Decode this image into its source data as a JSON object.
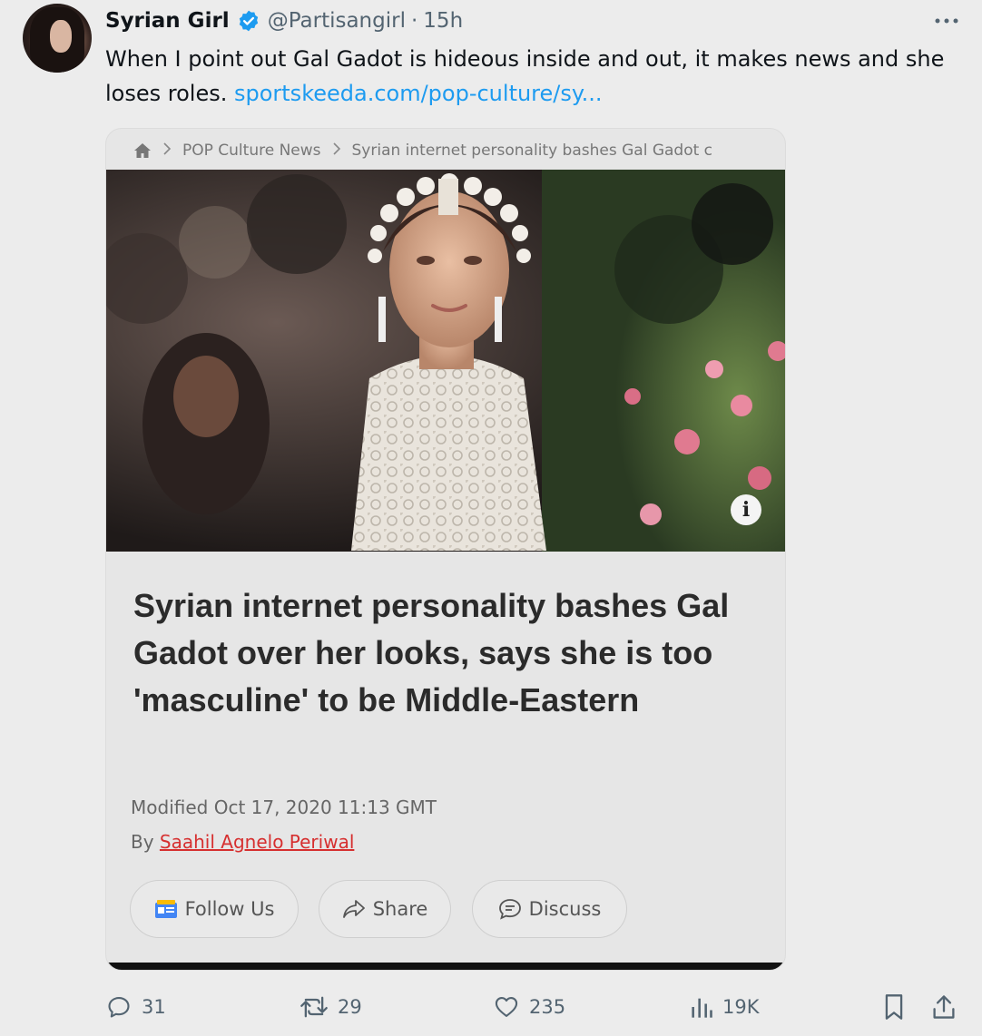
{
  "tweet": {
    "author_name": "Syrian Girl",
    "handle": "@Partisangirl",
    "separator": "·",
    "time": "15h",
    "text": "When I point out Gal Gadot is hideous inside and out, it makes news and she loses roles. ",
    "link_text": "sportskeeda.com/pop-culture/sy..."
  },
  "card": {
    "breadcrumb": {
      "section": "POP Culture News",
      "current": "Syrian internet personality bashes Gal Gadot c"
    },
    "headline": "Syrian internet personality bashes Gal Gadot over her looks, says she is too 'masculine' to be Middle-Eastern",
    "modified": "Modified Oct 17, 2020 11:13 GMT",
    "by_prefix": "By ",
    "author": "Saahil Agnelo Periwal",
    "buttons": {
      "follow": "Follow Us",
      "share": "Share",
      "discuss": "Discuss"
    },
    "info_glyph": "i"
  },
  "actions": {
    "replies": "31",
    "retweets": "29",
    "likes": "235",
    "views": "19K"
  },
  "colors": {
    "accent": "#1d9bf0",
    "author_link": "#d62f2f",
    "background": "#ececec"
  },
  "icons": [
    "verified-badge-icon",
    "more-icon",
    "home-icon",
    "chevron-right-icon",
    "info-icon",
    "google-news-icon",
    "share-arrow-icon",
    "discuss-bubble-icon",
    "reply-icon",
    "retweet-icon",
    "like-icon",
    "views-icon",
    "bookmark-icon",
    "share-icon"
  ]
}
